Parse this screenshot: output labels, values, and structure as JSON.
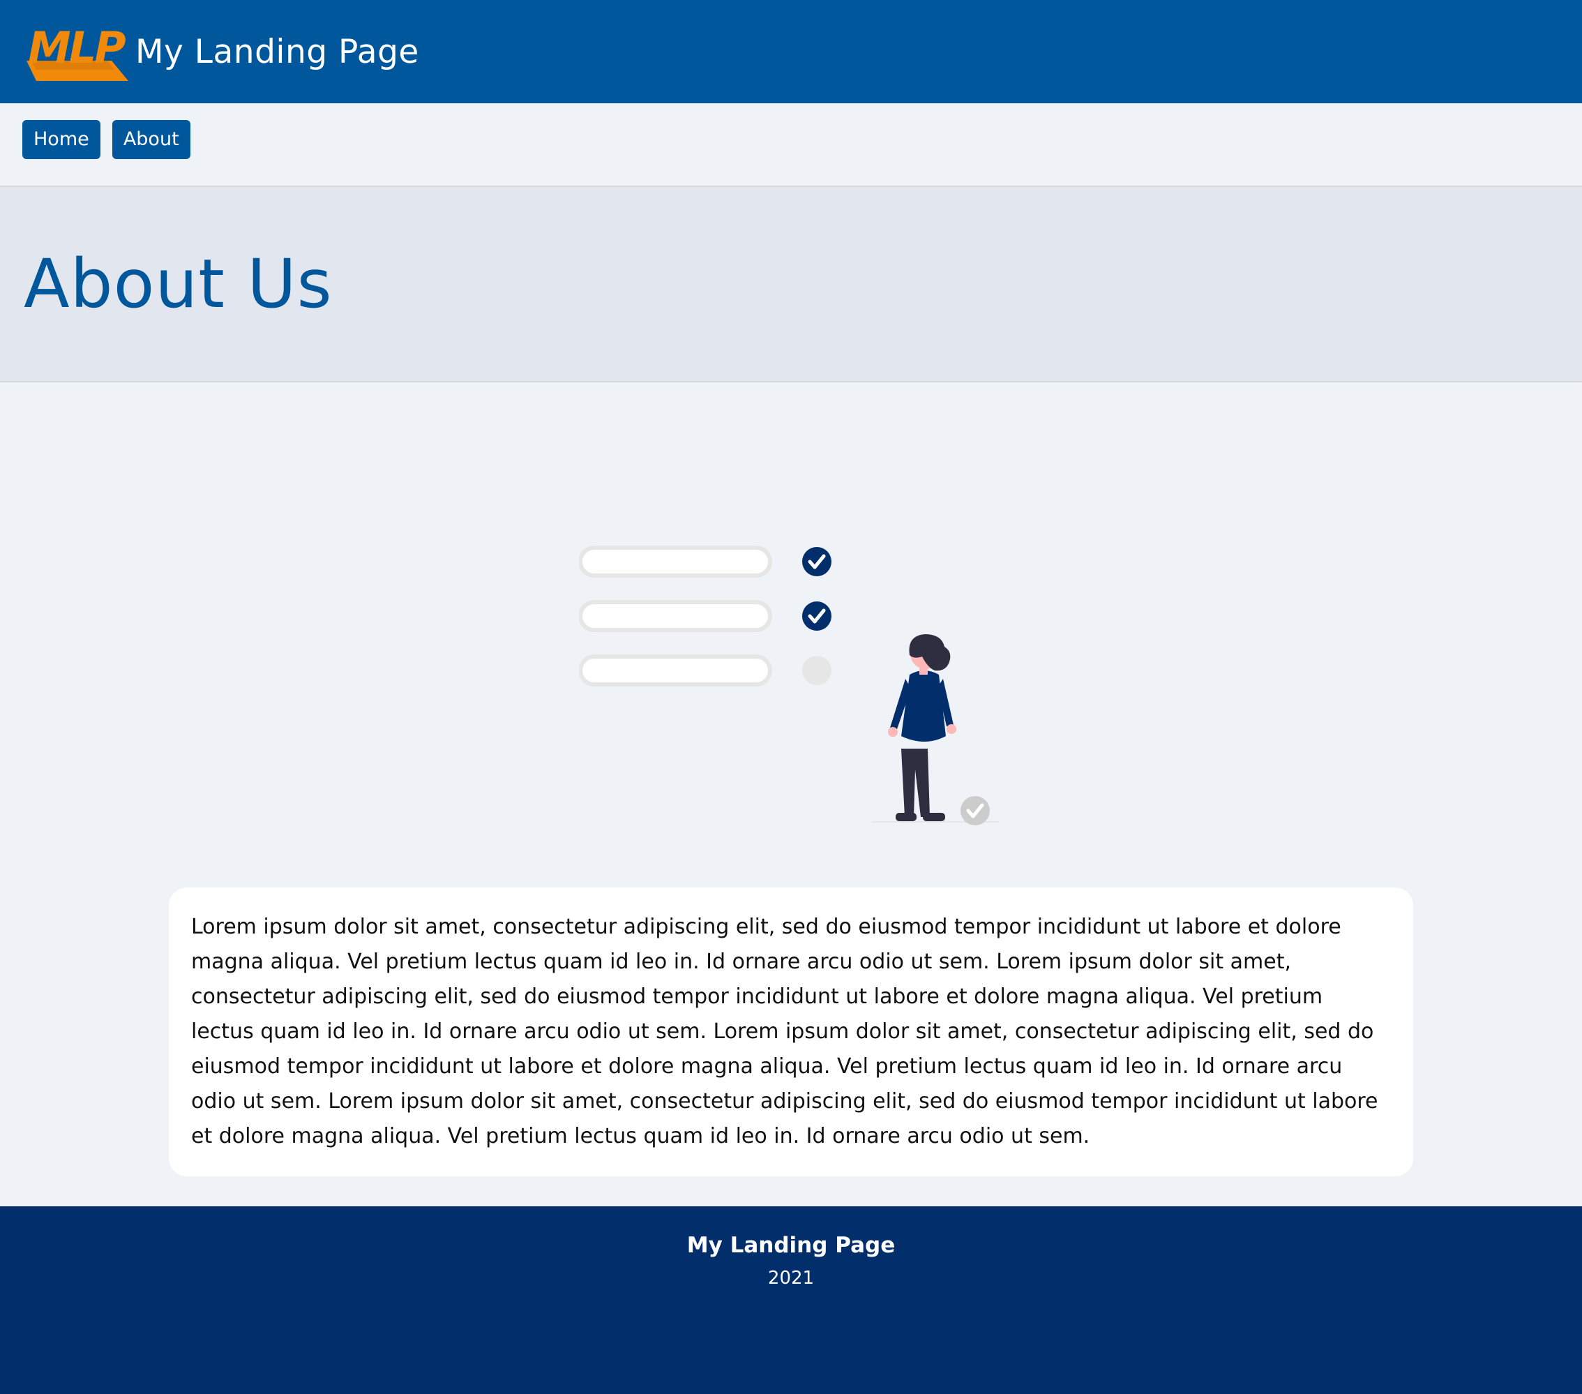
{
  "header": {
    "logo_text": "MLP",
    "title": "My Landing Page"
  },
  "nav": {
    "items": [
      {
        "label": "Home"
      },
      {
        "label": "About"
      }
    ]
  },
  "hero": {
    "title": "About Us"
  },
  "main": {
    "illustration": {
      "checklist_items": [
        {
          "checked": true
        },
        {
          "checked": true
        },
        {
          "checked": false
        }
      ]
    },
    "body_text": "Lorem ipsum dolor sit amet, consectetur adipiscing elit, sed do eiusmod tempor incididunt ut labore et dolore magna aliqua. Vel pretium lectus quam id leo in. Id ornare arcu odio ut sem. Lorem ipsum dolor sit amet, consectetur adipiscing elit, sed do eiusmod tempor incididunt ut labore et dolore magna aliqua. Vel pretium lectus quam id leo in. Id ornare arcu odio ut sem. Lorem ipsum dolor sit amet, consectetur adipiscing elit, sed do eiusmod tempor incididunt ut labore et dolore magna aliqua. Vel pretium lectus quam id leo in. Id ornare arcu odio ut sem. Lorem ipsum dolor sit amet, consectetur adipiscing elit, sed do eiusmod tempor incididunt ut labore et dolore magna aliqua. Vel pretium lectus quam id leo in. Id ornare arcu odio ut sem."
  },
  "footer": {
    "title": "My Landing Page",
    "year": "2021"
  },
  "colors": {
    "header_bg": "#01579b",
    "logo_orange": "#f18a0a",
    "page_bg": "#eff2f7",
    "hero_bg": "#e2e6ee",
    "footer_bg": "#022e6b",
    "check_navy": "#022e6b"
  }
}
